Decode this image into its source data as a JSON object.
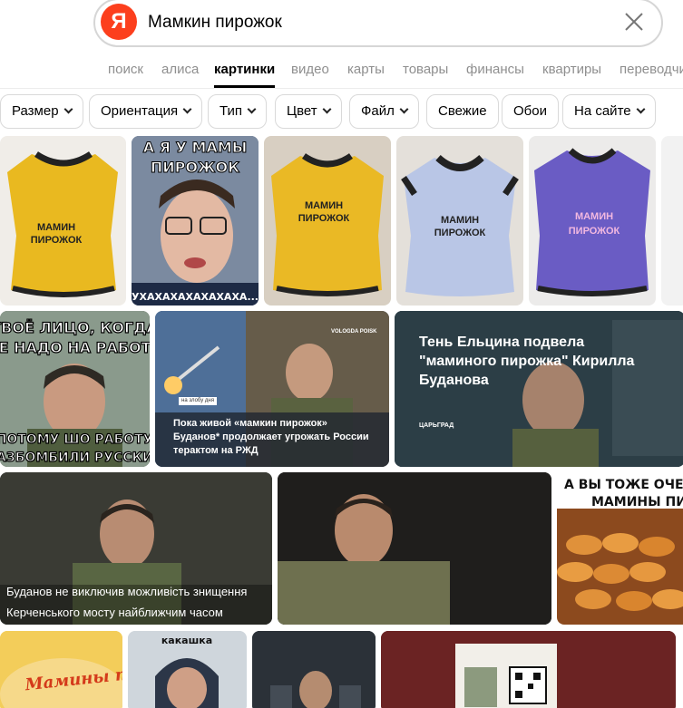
{
  "search": {
    "logo_letter": "Я",
    "query": "Мамкин пирожок"
  },
  "tabs": [
    {
      "label": "поиск",
      "active": false
    },
    {
      "label": "алиса",
      "active": false
    },
    {
      "label": "картинки",
      "active": true
    },
    {
      "label": "видео",
      "active": false
    },
    {
      "label": "карты",
      "active": false
    },
    {
      "label": "товары",
      "active": false
    },
    {
      "label": "финансы",
      "active": false
    },
    {
      "label": "квартиры",
      "active": false
    },
    {
      "label": "переводчик",
      "active": false
    }
  ],
  "filters": [
    {
      "label": "Размер",
      "dropdown": true
    },
    {
      "label": "Ориентация",
      "dropdown": true
    },
    {
      "label": "Тип",
      "dropdown": true
    },
    {
      "label": "Цвет",
      "dropdown": true
    },
    {
      "label": "Файл",
      "dropdown": true
    },
    {
      "label": "Свежие",
      "dropdown": false
    },
    {
      "label": "Обои",
      "dropdown": false
    },
    {
      "label": "На сайте",
      "dropdown": true
    }
  ],
  "images": {
    "shirt_label_line1": "МАМИН",
    "shirt_label_line2": "ПИРОЖОК",
    "meme1_top_line1": "А Я У МАМЫ",
    "meme1_top_line2": "ПИРОЖОК",
    "meme1_bottom": "УХАХАХАХАХАХАХА...",
    "meme2_top_line1": "ТВОЁ ЛИЦО, КОГДА",
    "meme2_top_line2": "НЕ НАДО НА РАБОТУ",
    "meme2_bottom_line1": "ПОТОМУ ШО РАБОТУ",
    "meme2_bottom_line2": "РАЗБОМБИЛИ РУССКИЕ",
    "news1_tag": "на злобу дня",
    "news1_caption": "Пока живой «мамкин пирожок» Буданов* продолжает угрожать России терактом на РЖД",
    "news1_source": "VOLOGDA POISK",
    "news2_headline_line1": "Тень Ельцина подвела",
    "news2_headline_line2": "\"маминого пирожка\" Кирилла",
    "news2_headline_line3": "Буданова",
    "news2_source": "ЦАРЬГРАД",
    "news3_caption_line1": "Буданов не виключив можливість знищення",
    "news3_caption_line2": "Керченського мосту найближчим часом",
    "meme3_top_line1": "А ВЫ ТОЖЕ ОЧЕ",
    "meme3_top_line2": "МАМИНЫ ПИ",
    "meme4_top": "какашка",
    "cake_text": "Мамины пирожки"
  },
  "colors": {
    "brand": "#fc3f1d",
    "shirt_yellow": "#e9b920",
    "shirt_blue": "#b9c6e6",
    "shirt_purple": "#6a5cc4"
  }
}
